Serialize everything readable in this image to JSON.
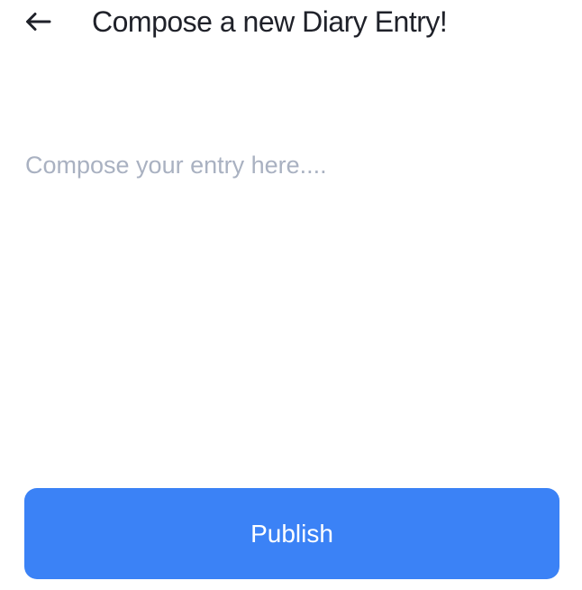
{
  "header": {
    "back_icon": "arrow-left-icon",
    "title": "Compose a new Diary Entry!"
  },
  "editor": {
    "value": "",
    "placeholder": "Compose your entry here...."
  },
  "actions": {
    "publish_label": "Publish"
  },
  "colors": {
    "accent": "#3b82f6",
    "title_text": "#1f2129",
    "placeholder_text": "#a9b1c1",
    "background": "#ffffff"
  }
}
